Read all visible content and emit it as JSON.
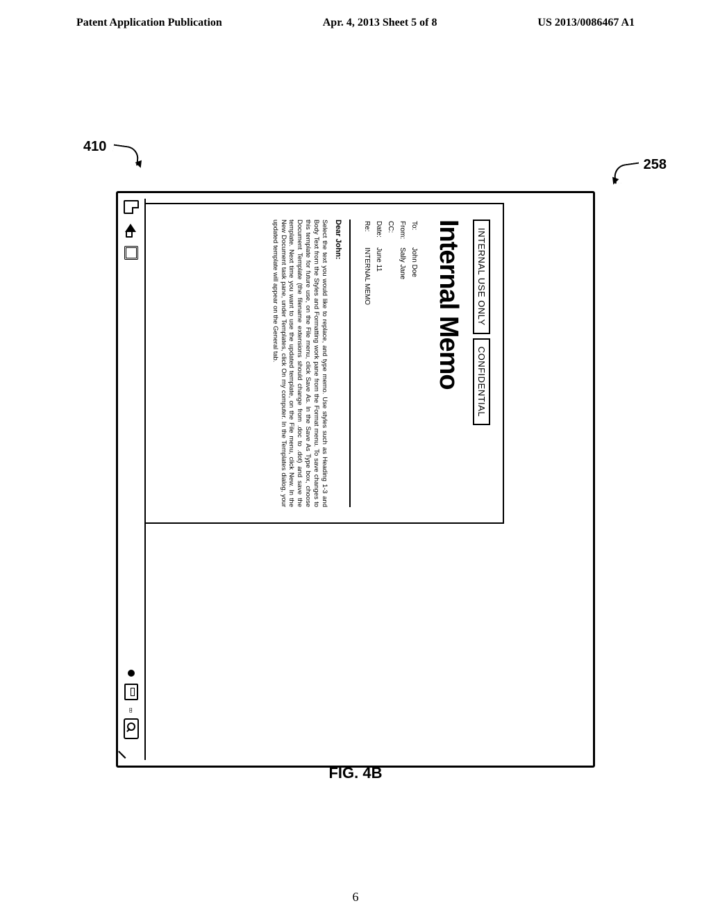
{
  "header": {
    "left": "Patent Application Publication",
    "center": "Apr. 4, 2013  Sheet 5 of 8",
    "right": "US 2013/0086467 A1"
  },
  "refs": {
    "r410": "410",
    "r258": "258"
  },
  "document": {
    "tags": [
      "INTERNAL USE ONLY",
      "CONFIDENTIAL"
    ],
    "title": "Internal Memo",
    "fields": {
      "to_label": "To:",
      "to_value": "John Doe",
      "from_label": "From:",
      "from_value": "Sally Jane",
      "cc_label": "CC:",
      "cc_value": "",
      "date_label": "Date:",
      "date_value": "June 11",
      "re_label": "Re:",
      "re_value": "INTERNAL MEMO"
    },
    "salutation": "Dear John:",
    "body": "Select the text you would like to replace, and type memo. Use styles such as Heading 1-3 and Body Text from the Styles and Formatting work pane from the Format menu. To save changes to this template for future use, on the File menu, click Save As. In the Save As Type box, choose Document Template (the filename extensions should change from .doc to .dot) and save the template. Next time you want to use the updated template, on the File menu, click New. In the New Document task pane, under Templates, click On my computer. In the Templates dialog, your updated template will appear on the General tab."
  },
  "figure_label": "FIG. 4B",
  "page_number": "6"
}
